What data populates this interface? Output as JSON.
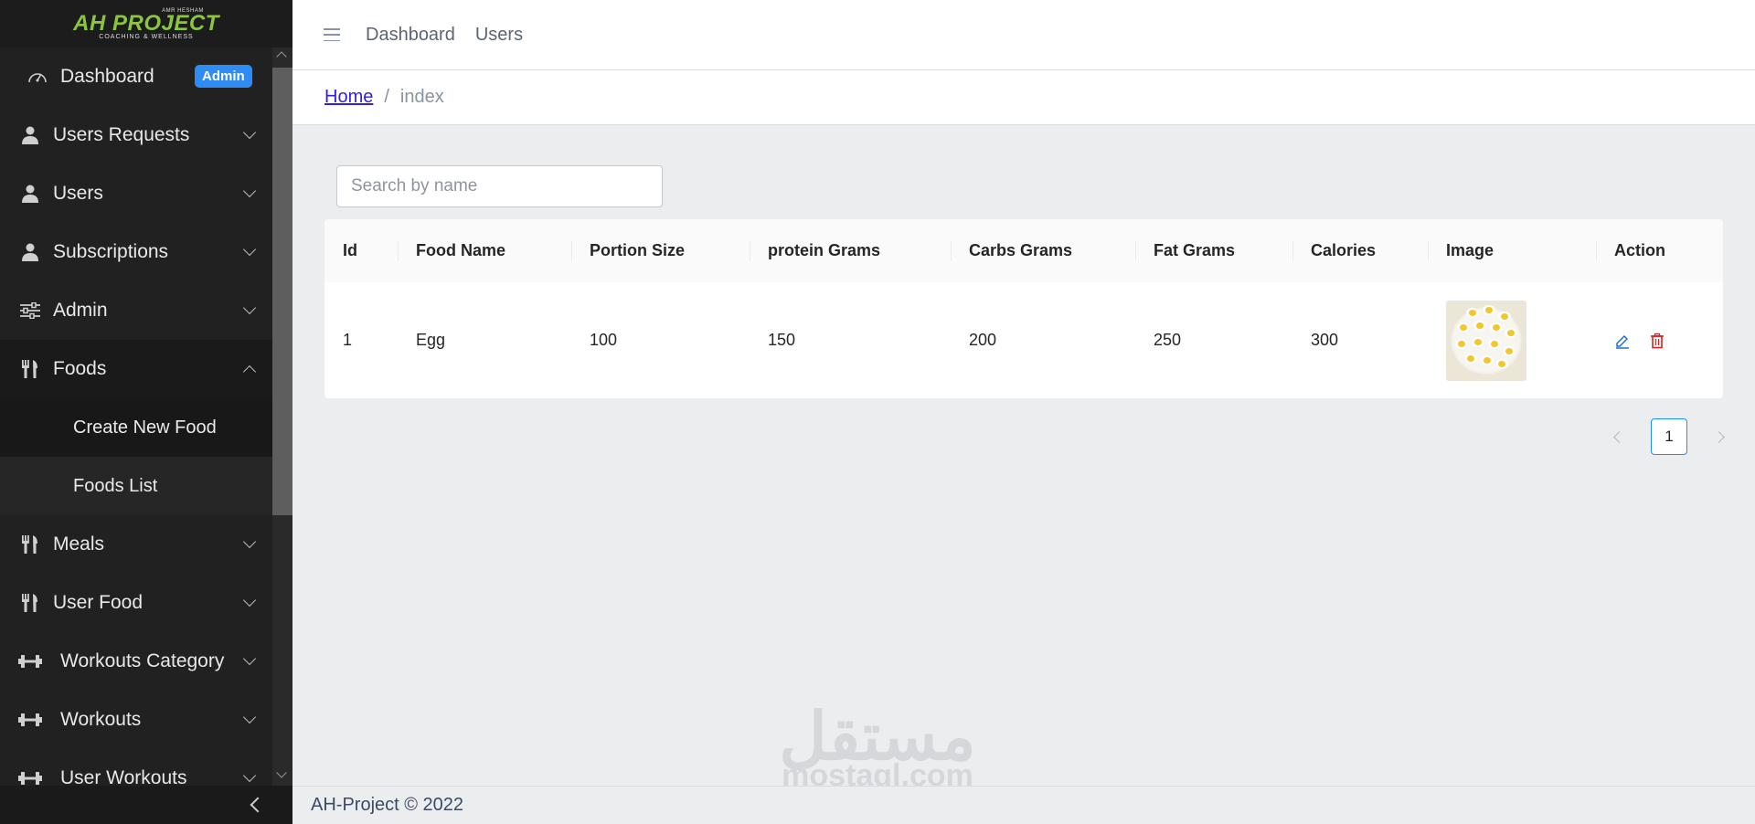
{
  "brand": {
    "top": "AMR HESHAM",
    "main": "AH PROJECT",
    "sub": "COACHING & WELLNESS",
    "accent": "#8ac540"
  },
  "sidebar": {
    "items": [
      {
        "label": "Dashboard",
        "icon": "speedometer-icon",
        "badge": "Admin"
      },
      {
        "label": "Users Requests",
        "icon": "user-icon"
      },
      {
        "label": "Users",
        "icon": "user-icon"
      },
      {
        "label": "Subscriptions",
        "icon": "user-icon"
      },
      {
        "label": "Admin",
        "icon": "sliders-icon"
      },
      {
        "label": "Foods",
        "icon": "cutlery-icon",
        "expanded": true,
        "children": [
          {
            "label": "Create New Food"
          },
          {
            "label": "Foods List",
            "active": true
          }
        ]
      },
      {
        "label": "Meals",
        "icon": "cutlery-icon"
      },
      {
        "label": "User Food",
        "icon": "cutlery-icon"
      },
      {
        "label": "Workouts Category",
        "icon": "dumbbell-icon"
      },
      {
        "label": "Workouts",
        "icon": "dumbbell-icon"
      },
      {
        "label": "User Workouts",
        "icon": "dumbbell-icon"
      }
    ]
  },
  "header": {
    "links": [
      "Dashboard",
      "Users"
    ]
  },
  "breadcrumb": {
    "home": "Home",
    "separator": "/",
    "current": "index"
  },
  "search": {
    "placeholder": "Search by name",
    "value": ""
  },
  "table": {
    "columns": [
      "Id",
      "Food Name",
      "Portion Size",
      "protein Grams",
      "Carbs Grams",
      "Fat Grams",
      "Calories",
      "Image",
      "Action"
    ],
    "rows": [
      {
        "id": "1",
        "name": "Egg",
        "portion": "100",
        "protein": "150",
        "carbs": "200",
        "fat": "250",
        "calories": "300",
        "image": "boiled-eggs-image"
      }
    ]
  },
  "pagination": {
    "current": "1"
  },
  "watermark": {
    "arabic": "مستقل",
    "latin": "mostaql.com"
  },
  "footer": {
    "text": "AH-Project © 2022"
  }
}
